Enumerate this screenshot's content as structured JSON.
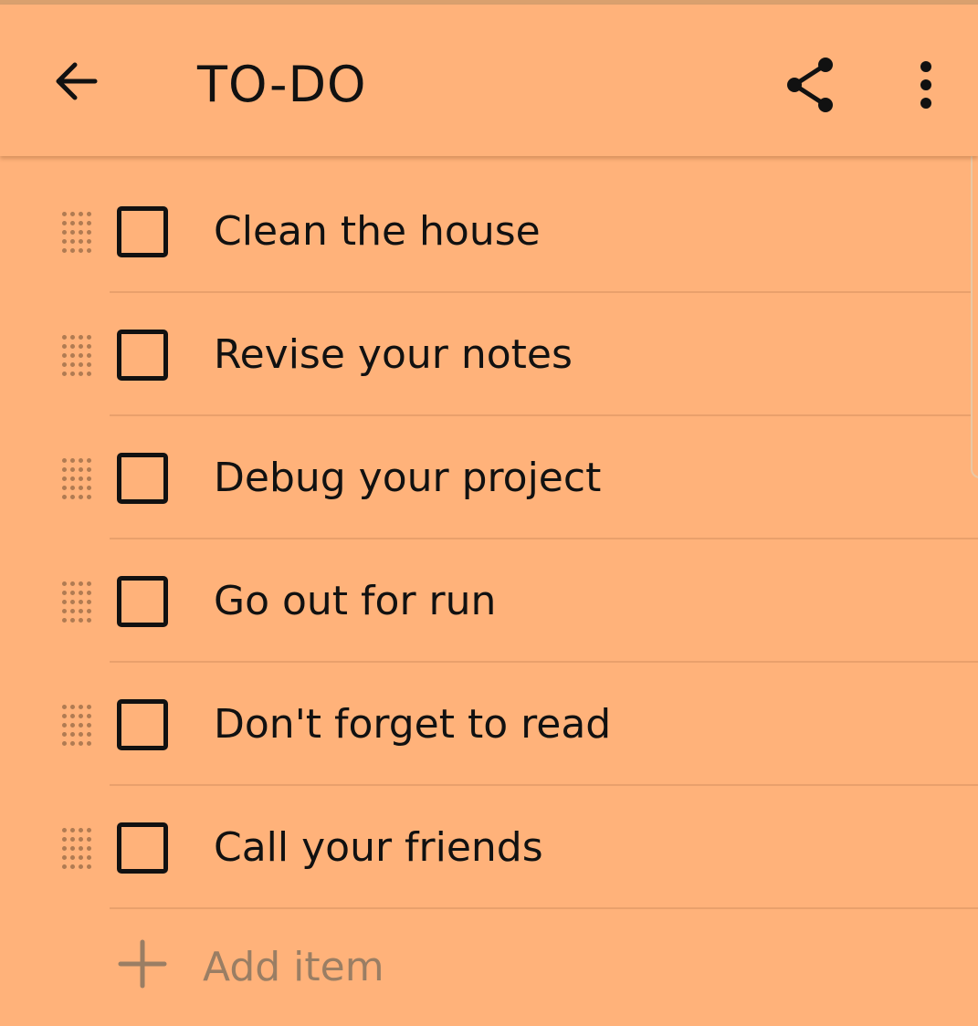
{
  "header": {
    "title": "TO-DO",
    "back_icon": "arrow-left-icon",
    "share_icon": "share-icon",
    "more_icon": "more-vert-icon"
  },
  "colors": {
    "background": "#FFB27A",
    "divider": "#E9A06C",
    "text": "#111111",
    "placeholder": "#9A7E64"
  },
  "items": [
    {
      "label": "Clean the house",
      "checked": false
    },
    {
      "label": "Revise your notes",
      "checked": false
    },
    {
      "label": "Debug your project",
      "checked": false
    },
    {
      "label": "Go out for run",
      "checked": false
    },
    {
      "label": "Don't forget to read",
      "checked": false
    },
    {
      "label": "Call your friends",
      "checked": false
    }
  ],
  "add_item": {
    "label": "Add item",
    "icon": "plus-icon"
  }
}
